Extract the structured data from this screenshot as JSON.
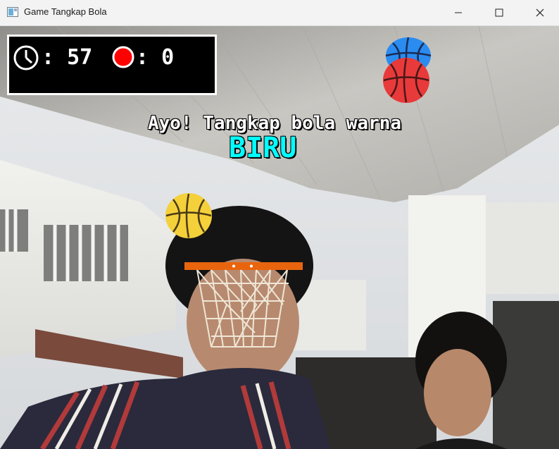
{
  "window": {
    "title": "Game Tangkap Bola",
    "controls": [
      "minimize",
      "maximize",
      "close"
    ]
  },
  "hud": {
    "timer_icon": "clock-icon",
    "timer_value": "57",
    "timer_separator": ":",
    "score_icon": "red-ball-dot-icon",
    "score_value": "0",
    "score_separator": ":"
  },
  "instruction": {
    "line": "Ayo! Tangkap bola warna",
    "target_color_name": "BIRU",
    "target_color_hex": "#00ffff"
  },
  "balls": [
    {
      "name": "blue-ball",
      "color": "#2a8cf0"
    },
    {
      "name": "red-ball",
      "color": "#e83a3a"
    },
    {
      "name": "yellow-ball",
      "color": "#f4d03a"
    }
  ],
  "hoop": {
    "rim_color": "#e8650e",
    "net_color": "#f0e8d8"
  },
  "colors": {
    "hud_bg": "#000000",
    "hud_border": "#ffffff",
    "score_dot": "#ff0000"
  }
}
